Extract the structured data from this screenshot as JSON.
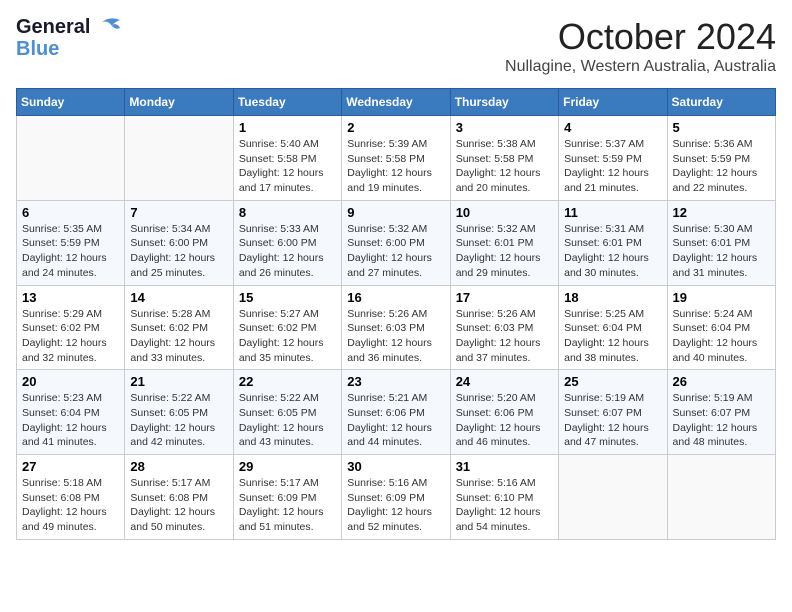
{
  "logo": {
    "general": "General",
    "blue": "Blue"
  },
  "title": {
    "month_year": "October 2024",
    "location": "Nullagine, Western Australia, Australia"
  },
  "weekdays": [
    "Sunday",
    "Monday",
    "Tuesday",
    "Wednesday",
    "Thursday",
    "Friday",
    "Saturday"
  ],
  "weeks": [
    [
      {
        "day": "",
        "content": ""
      },
      {
        "day": "",
        "content": ""
      },
      {
        "day": "1",
        "content": "Sunrise: 5:40 AM\nSunset: 5:58 PM\nDaylight: 12 hours and 17 minutes."
      },
      {
        "day": "2",
        "content": "Sunrise: 5:39 AM\nSunset: 5:58 PM\nDaylight: 12 hours and 19 minutes."
      },
      {
        "day": "3",
        "content": "Sunrise: 5:38 AM\nSunset: 5:58 PM\nDaylight: 12 hours and 20 minutes."
      },
      {
        "day": "4",
        "content": "Sunrise: 5:37 AM\nSunset: 5:59 PM\nDaylight: 12 hours and 21 minutes."
      },
      {
        "day": "5",
        "content": "Sunrise: 5:36 AM\nSunset: 5:59 PM\nDaylight: 12 hours and 22 minutes."
      }
    ],
    [
      {
        "day": "6",
        "content": "Sunrise: 5:35 AM\nSunset: 5:59 PM\nDaylight: 12 hours and 24 minutes."
      },
      {
        "day": "7",
        "content": "Sunrise: 5:34 AM\nSunset: 6:00 PM\nDaylight: 12 hours and 25 minutes."
      },
      {
        "day": "8",
        "content": "Sunrise: 5:33 AM\nSunset: 6:00 PM\nDaylight: 12 hours and 26 minutes."
      },
      {
        "day": "9",
        "content": "Sunrise: 5:32 AM\nSunset: 6:00 PM\nDaylight: 12 hours and 27 minutes."
      },
      {
        "day": "10",
        "content": "Sunrise: 5:32 AM\nSunset: 6:01 PM\nDaylight: 12 hours and 29 minutes."
      },
      {
        "day": "11",
        "content": "Sunrise: 5:31 AM\nSunset: 6:01 PM\nDaylight: 12 hours and 30 minutes."
      },
      {
        "day": "12",
        "content": "Sunrise: 5:30 AM\nSunset: 6:01 PM\nDaylight: 12 hours and 31 minutes."
      }
    ],
    [
      {
        "day": "13",
        "content": "Sunrise: 5:29 AM\nSunset: 6:02 PM\nDaylight: 12 hours and 32 minutes."
      },
      {
        "day": "14",
        "content": "Sunrise: 5:28 AM\nSunset: 6:02 PM\nDaylight: 12 hours and 33 minutes."
      },
      {
        "day": "15",
        "content": "Sunrise: 5:27 AM\nSunset: 6:02 PM\nDaylight: 12 hours and 35 minutes."
      },
      {
        "day": "16",
        "content": "Sunrise: 5:26 AM\nSunset: 6:03 PM\nDaylight: 12 hours and 36 minutes."
      },
      {
        "day": "17",
        "content": "Sunrise: 5:26 AM\nSunset: 6:03 PM\nDaylight: 12 hours and 37 minutes."
      },
      {
        "day": "18",
        "content": "Sunrise: 5:25 AM\nSunset: 6:04 PM\nDaylight: 12 hours and 38 minutes."
      },
      {
        "day": "19",
        "content": "Sunrise: 5:24 AM\nSunset: 6:04 PM\nDaylight: 12 hours and 40 minutes."
      }
    ],
    [
      {
        "day": "20",
        "content": "Sunrise: 5:23 AM\nSunset: 6:04 PM\nDaylight: 12 hours and 41 minutes."
      },
      {
        "day": "21",
        "content": "Sunrise: 5:22 AM\nSunset: 6:05 PM\nDaylight: 12 hours and 42 minutes."
      },
      {
        "day": "22",
        "content": "Sunrise: 5:22 AM\nSunset: 6:05 PM\nDaylight: 12 hours and 43 minutes."
      },
      {
        "day": "23",
        "content": "Sunrise: 5:21 AM\nSunset: 6:06 PM\nDaylight: 12 hours and 44 minutes."
      },
      {
        "day": "24",
        "content": "Sunrise: 5:20 AM\nSunset: 6:06 PM\nDaylight: 12 hours and 46 minutes."
      },
      {
        "day": "25",
        "content": "Sunrise: 5:19 AM\nSunset: 6:07 PM\nDaylight: 12 hours and 47 minutes."
      },
      {
        "day": "26",
        "content": "Sunrise: 5:19 AM\nSunset: 6:07 PM\nDaylight: 12 hours and 48 minutes."
      }
    ],
    [
      {
        "day": "27",
        "content": "Sunrise: 5:18 AM\nSunset: 6:08 PM\nDaylight: 12 hours and 49 minutes."
      },
      {
        "day": "28",
        "content": "Sunrise: 5:17 AM\nSunset: 6:08 PM\nDaylight: 12 hours and 50 minutes."
      },
      {
        "day": "29",
        "content": "Sunrise: 5:17 AM\nSunset: 6:09 PM\nDaylight: 12 hours and 51 minutes."
      },
      {
        "day": "30",
        "content": "Sunrise: 5:16 AM\nSunset: 6:09 PM\nDaylight: 12 hours and 52 minutes."
      },
      {
        "day": "31",
        "content": "Sunrise: 5:16 AM\nSunset: 6:10 PM\nDaylight: 12 hours and 54 minutes."
      },
      {
        "day": "",
        "content": ""
      },
      {
        "day": "",
        "content": ""
      }
    ]
  ]
}
